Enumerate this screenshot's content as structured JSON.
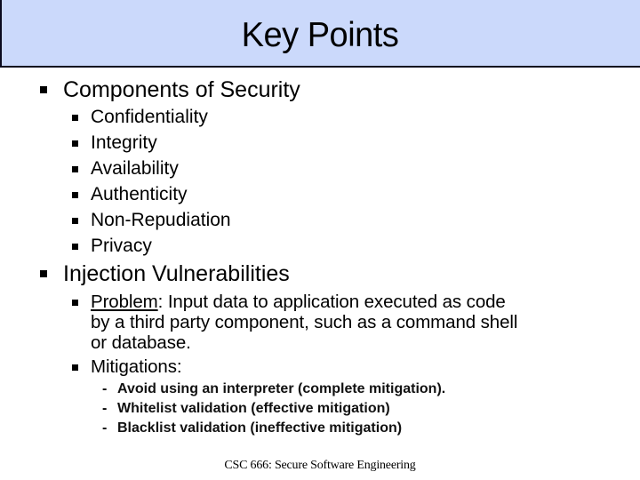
{
  "slide": {
    "title": "Key Points",
    "colors": {
      "title_fill": "#cbd9fb",
      "title_border": "#0a0a1e"
    },
    "sections": [
      {
        "heading": "Components of Security",
        "items": [
          "Confidentiality",
          "Integrity",
          "Availability",
          "Authenticity",
          "Non-Repudiation",
          "Privacy"
        ]
      },
      {
        "heading": "Injection Vulnerabilities",
        "problem": {
          "label": "Problem",
          "line1": ": Input data to application executed as code",
          "line2": "by a third party component, such as a command shell",
          "line3": "or database."
        },
        "mitigations": {
          "label": "Mitigations:",
          "dash": "-",
          "items": [
            "Avoid using an interpreter (complete mitigation).",
            "Whitelist validation (effective mitigation)",
            "Blacklist validation (ineffective mitigation)"
          ]
        }
      }
    ],
    "footer": "CSC 666: Secure Software Engineering"
  }
}
